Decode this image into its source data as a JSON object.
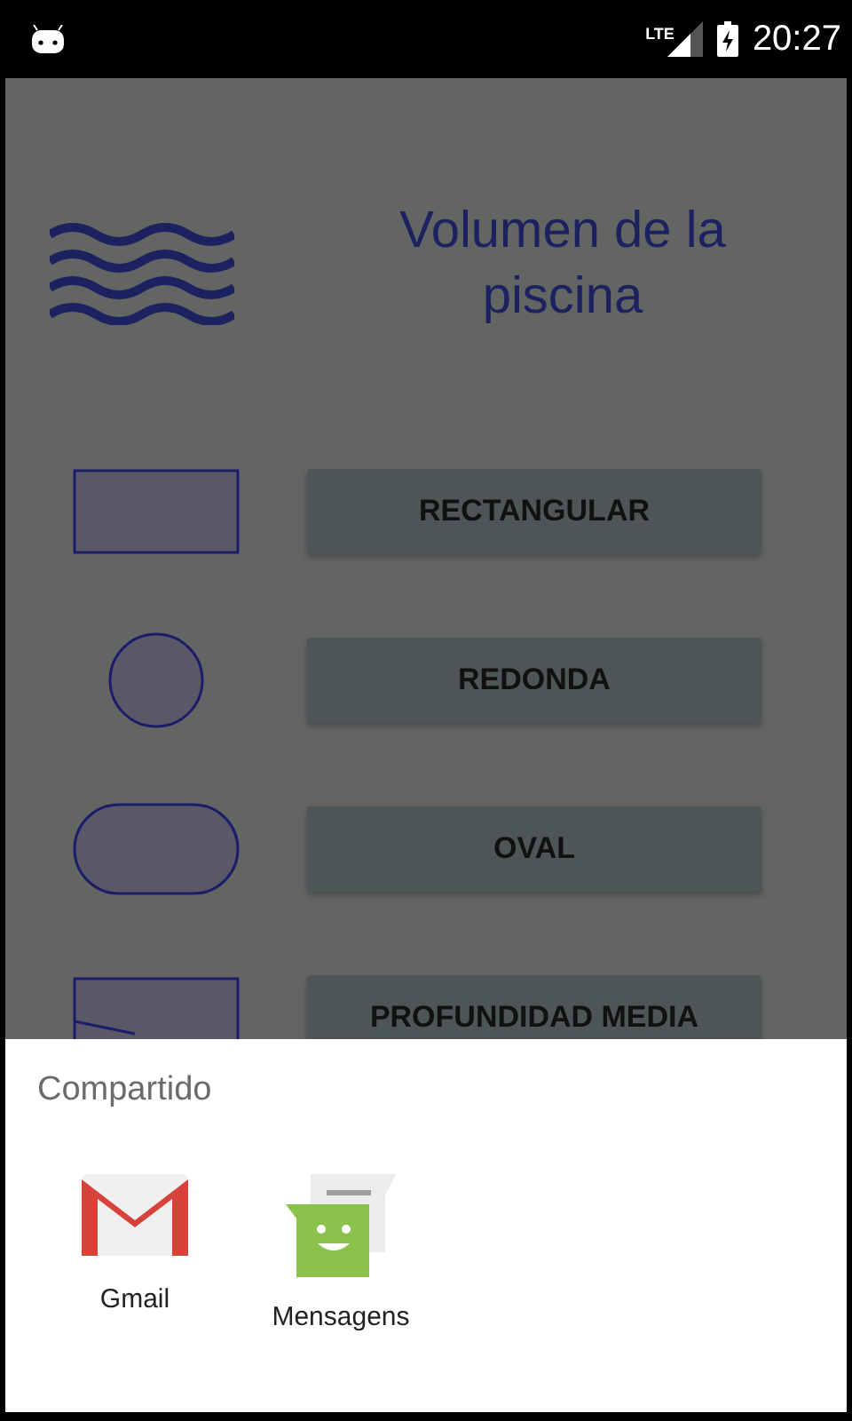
{
  "status_bar": {
    "network": "LTE",
    "time": "20:27"
  },
  "title": "Volumen de la piscina",
  "shapes": [
    {
      "kind": "rectangle",
      "label": "RECTANGULAR"
    },
    {
      "kind": "circle",
      "label": "REDONDA"
    },
    {
      "kind": "oval",
      "label": "OVAL"
    },
    {
      "kind": "sloped",
      "label": "PROFUNDIDAD MEDIA"
    }
  ],
  "share_sheet": {
    "title": "Compartido",
    "apps": [
      {
        "kind": "gmail",
        "label": "Gmail"
      },
      {
        "kind": "messages",
        "label": "Mensagens"
      }
    ]
  }
}
